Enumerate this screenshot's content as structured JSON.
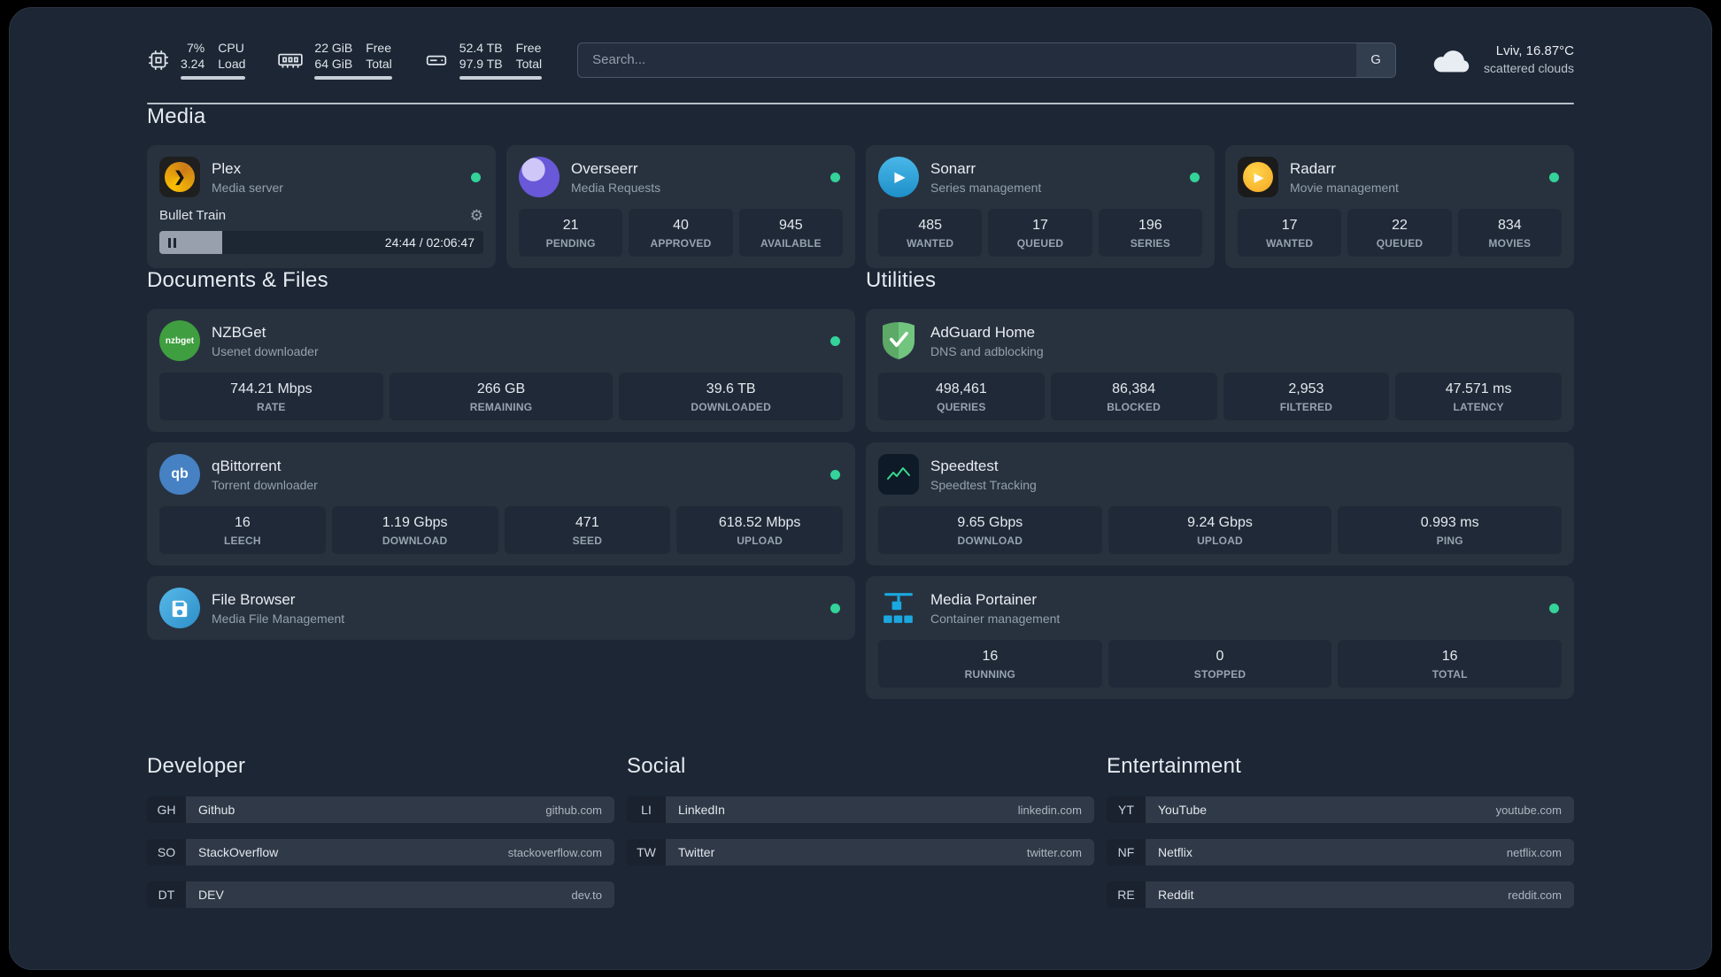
{
  "topbar": {
    "cpu": {
      "value_top": "7%",
      "value_bottom": "3.24",
      "label_top": "CPU",
      "label_bottom": "Load",
      "bar_percent": 100
    },
    "memory": {
      "value_top": "22 GiB",
      "value_bottom": "64 GiB",
      "label_top": "Free",
      "label_bottom": "Total",
      "bar_percent": 100
    },
    "disk": {
      "value_top": "52.4 TB",
      "value_bottom": "97.9 TB",
      "label_top": "Free",
      "label_bottom": "Total",
      "bar_percent": 100
    },
    "search": {
      "placeholder": "Search...",
      "button": "G"
    },
    "weather": {
      "location": "Lviv, 16.87°C",
      "condition": "scattered clouds"
    }
  },
  "sections": {
    "media": {
      "title": "Media",
      "cards": [
        {
          "name": "Plex",
          "description": "Media server",
          "status": "online",
          "player": {
            "title": "Bullet Train",
            "time": "24:44 / 02:06:47",
            "progress_percent": 19.5
          }
        },
        {
          "name": "Overseerr",
          "description": "Media Requests",
          "status": "online",
          "stats": [
            {
              "value": "21",
              "label": "PENDING"
            },
            {
              "value": "40",
              "label": "APPROVED"
            },
            {
              "value": "945",
              "label": "AVAILABLE"
            }
          ]
        },
        {
          "name": "Sonarr",
          "description": "Series management",
          "status": "online",
          "stats": [
            {
              "value": "485",
              "label": "WANTED"
            },
            {
              "value": "17",
              "label": "QUEUED"
            },
            {
              "value": "196",
              "label": "SERIES"
            }
          ]
        },
        {
          "name": "Radarr",
          "description": "Movie management",
          "status": "online",
          "stats": [
            {
              "value": "17",
              "label": "WANTED"
            },
            {
              "value": "22",
              "label": "QUEUED"
            },
            {
              "value": "834",
              "label": "MOVIES"
            }
          ]
        }
      ]
    },
    "documents": {
      "title": "Documents & Files",
      "cards": [
        {
          "name": "NZBGet",
          "description": "Usenet downloader",
          "status": "online",
          "stats": [
            {
              "value": "744.21 Mbps",
              "label": "RATE"
            },
            {
              "value": "266 GB",
              "label": "REMAINING"
            },
            {
              "value": "39.6 TB",
              "label": "DOWNLOADED"
            }
          ]
        },
        {
          "name": "qBittorrent",
          "description": "Torrent downloader",
          "status": "online",
          "stats": [
            {
              "value": "16",
              "label": "LEECH"
            },
            {
              "value": "1.19 Gbps",
              "label": "DOWNLOAD"
            },
            {
              "value": "471",
              "label": "SEED"
            },
            {
              "value": "618.52 Mbps",
              "label": "UPLOAD"
            }
          ]
        },
        {
          "name": "File Browser",
          "description": "Media File Management",
          "status": "online",
          "stats": []
        }
      ]
    },
    "utilities": {
      "title": "Utilities",
      "cards": [
        {
          "name": "AdGuard Home",
          "description": "DNS and adblocking",
          "stats": [
            {
              "value": "498,461",
              "label": "QUERIES"
            },
            {
              "value": "86,384",
              "label": "BLOCKED"
            },
            {
              "value": "2,953",
              "label": "FILTERED"
            },
            {
              "value": "47.571 ms",
              "label": "LATENCY"
            }
          ]
        },
        {
          "name": "Speedtest",
          "description": "Speedtest Tracking",
          "stats": [
            {
              "value": "9.65 Gbps",
              "label": "DOWNLOAD"
            },
            {
              "value": "9.24 Gbps",
              "label": "UPLOAD"
            },
            {
              "value": "0.993 ms",
              "label": "PING"
            }
          ]
        },
        {
          "name": "Media Portainer",
          "description": "Container management",
          "status": "online",
          "stats": [
            {
              "value": "16",
              "label": "RUNNING"
            },
            {
              "value": "0",
              "label": "STOPPED"
            },
            {
              "value": "16",
              "label": "TOTAL"
            }
          ]
        }
      ]
    }
  },
  "bookmarks": {
    "developer": {
      "title": "Developer",
      "items": [
        {
          "abbr": "GH",
          "name": "Github",
          "url": "github.com"
        },
        {
          "abbr": "SO",
          "name": "StackOverflow",
          "url": "stackoverflow.com"
        },
        {
          "abbr": "DT",
          "name": "DEV",
          "url": "dev.to"
        }
      ]
    },
    "social": {
      "title": "Social",
      "items": [
        {
          "abbr": "LI",
          "name": "LinkedIn",
          "url": "linkedin.com"
        },
        {
          "abbr": "TW",
          "name": "Twitter",
          "url": "twitter.com"
        }
      ]
    },
    "entertainment": {
      "title": "Entertainment",
      "items": [
        {
          "abbr": "YT",
          "name": "YouTube",
          "url": "youtube.com"
        },
        {
          "abbr": "NF",
          "name": "Netflix",
          "url": "netflix.com"
        },
        {
          "abbr": "RE",
          "name": "Reddit",
          "url": "reddit.com"
        }
      ]
    }
  },
  "colors": {
    "status_online": "#34d399",
    "resource_bar_fill": "#c8cfd9"
  }
}
